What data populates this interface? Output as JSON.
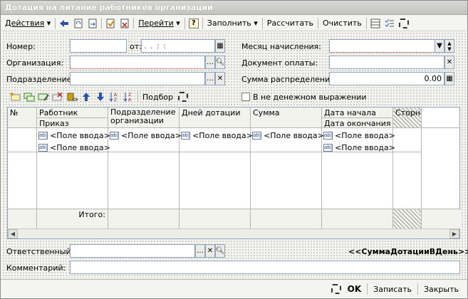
{
  "window": {
    "title": "Дотация на питание работников организации"
  },
  "toolbar": {
    "actions_label": "Действия",
    "goto_label": "Перейти",
    "fill_label": "Заполнить",
    "calculate_label": "Рассчитать",
    "clear_label": "Очистить",
    "help_label": "?"
  },
  "form": {
    "number_label": "Номер:",
    "number_value": "",
    "date_label": "от:",
    "date_value": ". .   : :",
    "organization_label": "Организация:",
    "organization_value": "",
    "department_label": "Подразделение:",
    "department_value": "",
    "month_label": "Месяц начисления:",
    "month_value": "",
    "payment_doc_label": "Документ оплаты:",
    "payment_doc_value": "",
    "sum_label": "Сумма распределения:",
    "sum_value": "0.00"
  },
  "table_toolbar": {
    "selection_label": "Подбор",
    "nonmonetary_label": "В не денежном выражении",
    "nonmonetary_checked": false
  },
  "table": {
    "headers": {
      "num": "№",
      "employee": "Работник",
      "order": "Приказ",
      "department": "Подразделение организации",
      "days": "Дней дотации",
      "sum": "Сумма",
      "date_start": "Дата начала",
      "date_end": "Дата окончания",
      "storno": "Сторно"
    },
    "input_placeholder": "<Поле ввода>",
    "footer_total": "Итого:"
  },
  "bottom_form": {
    "responsible_label": "Ответственный:",
    "responsible_value": "",
    "template_text": "<<СуммаДотацииВДень>>",
    "comment_label": "Комментарий:",
    "comment_value": ""
  },
  "buttons": {
    "ok": "OK",
    "save": "Записать",
    "close": "Закрыть"
  },
  "colors": {
    "field_border": "#8ea3c0",
    "required_underline": "#d22222",
    "title_bar": "#c4c4bf"
  }
}
